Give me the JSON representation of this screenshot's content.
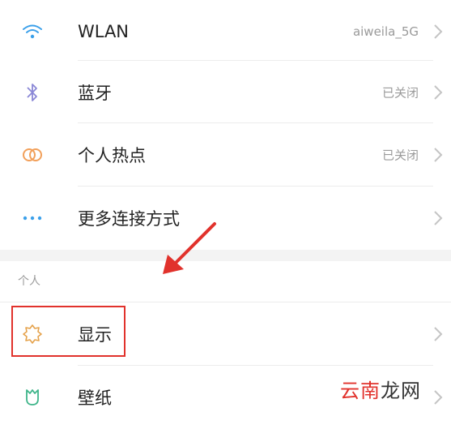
{
  "colors": {
    "wlan_icon": "#3ba0ea",
    "bluetooth_icon": "#8a87d6",
    "hotspot_icon": "#f2a05a",
    "more_icon": "#3ba0ea",
    "display_icon": "#e5a24b",
    "wallpaper_icon": "#3fb58a",
    "highlight": "#e1322c"
  },
  "rows": [
    {
      "label": "WLAN",
      "value": "aiweila_5G",
      "icon": "wifi-icon"
    },
    {
      "label": "蓝牙",
      "value": "已关闭",
      "icon": "bluetooth-icon"
    },
    {
      "label": "个人热点",
      "value": "已关闭",
      "icon": "hotspot-icon"
    },
    {
      "label": "更多连接方式",
      "value": "",
      "icon": "more-dots-icon"
    }
  ],
  "section": {
    "title": "个人"
  },
  "personal_rows": [
    {
      "label": "显示",
      "icon": "display-sun-icon"
    },
    {
      "label": "壁纸",
      "icon": "wallpaper-icon"
    }
  ],
  "watermark": {
    "red": "云南",
    "dark": "龙网"
  }
}
